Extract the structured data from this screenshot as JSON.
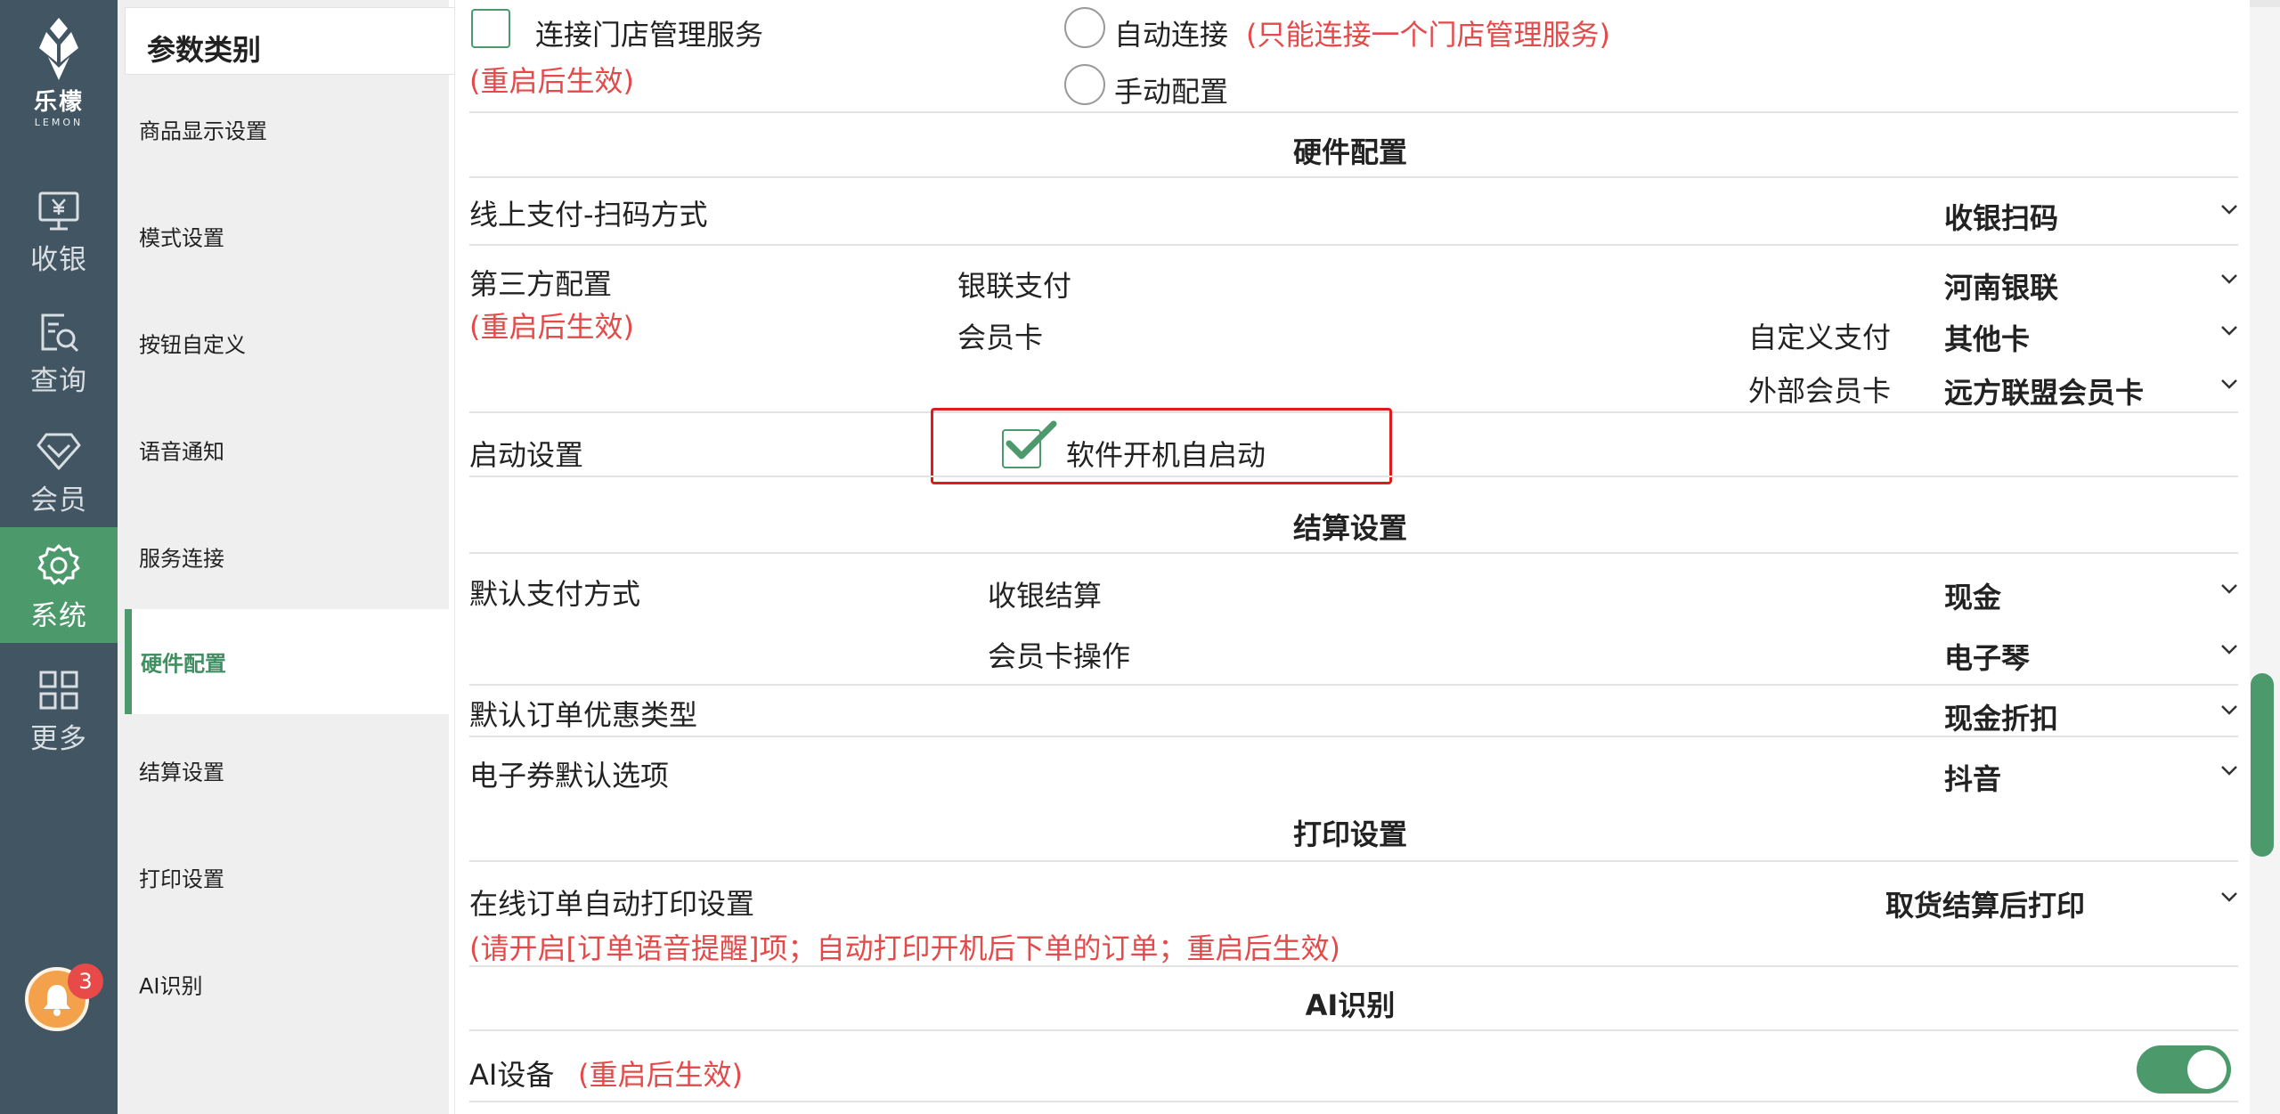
{
  "brand": {
    "name_cn": "乐檬",
    "name_en": "LEMON"
  },
  "nav": {
    "items": [
      {
        "label": "收银",
        "icon": "cashier-monitor-icon"
      },
      {
        "label": "查询",
        "icon": "search-document-icon"
      },
      {
        "label": "会员",
        "icon": "diamond-icon"
      },
      {
        "label": "系统",
        "icon": "gear-icon",
        "active": true
      },
      {
        "label": "更多",
        "icon": "grid-icon"
      }
    ],
    "notification_count": "3"
  },
  "categories": {
    "title": "参数类别",
    "items": [
      {
        "label": "商品显示设置"
      },
      {
        "label": "模式设置"
      },
      {
        "label": "按钮自定义"
      },
      {
        "label": "语音通知"
      },
      {
        "label": "服务连接"
      },
      {
        "label": "硬件配置",
        "active": true
      },
      {
        "label": "结算设置"
      },
      {
        "label": "打印设置"
      },
      {
        "label": "AI识别"
      }
    ]
  },
  "service": {
    "connect_label": "连接门店管理服务",
    "connect_checked": false,
    "restart_note": "(重启后生效)",
    "auto_label": "自动连接",
    "auto_note": "(只能连接一个门店管理服务)",
    "manual_label": "手动配置"
  },
  "hardware": {
    "section_title": "硬件配置",
    "online_pay_label": "线上支付-扫码方式",
    "online_pay_value": "收银扫码",
    "third_party_label": "第三方配置",
    "third_party_note": "(重启后生效)",
    "unionpay_label": "银联支付",
    "unionpay_value": "河南银联",
    "member_card_label": "会员卡",
    "custom_pay_label": "自定义支付",
    "custom_pay_value": "其他卡",
    "external_card_label": "外部会员卡",
    "external_card_value": "远方联盟会员卡",
    "startup_label": "启动设置",
    "autostart_label": "软件开机自启动",
    "autostart_checked": true
  },
  "settlement": {
    "section_title": "结算设置",
    "default_pay_label": "默认支付方式",
    "cashier_settle_label": "收银结算",
    "cashier_settle_value": "现金",
    "member_op_label": "会员卡操作",
    "member_op_value": "电子琴",
    "discount_label": "默认订单优惠类型",
    "discount_value": "现金折扣",
    "coupon_label": "电子券默认选项",
    "coupon_value": "抖音"
  },
  "print": {
    "section_title": "打印设置",
    "auto_print_label": "在线订单自动打印设置",
    "auto_print_value": "取货结算后打印",
    "auto_print_note": "(请开启[订单语音提醒]项；自动打印开机后下单的订单；重启后生效)"
  },
  "ai": {
    "section_title": "AI识别",
    "device_label": "AI设备",
    "device_note": "(重启后生效)",
    "device_enabled": true
  },
  "colors": {
    "accent": "#4c9a6c",
    "nav_bg": "#425563",
    "warning": "#e44a4a",
    "highlight": "#e01b1b"
  }
}
